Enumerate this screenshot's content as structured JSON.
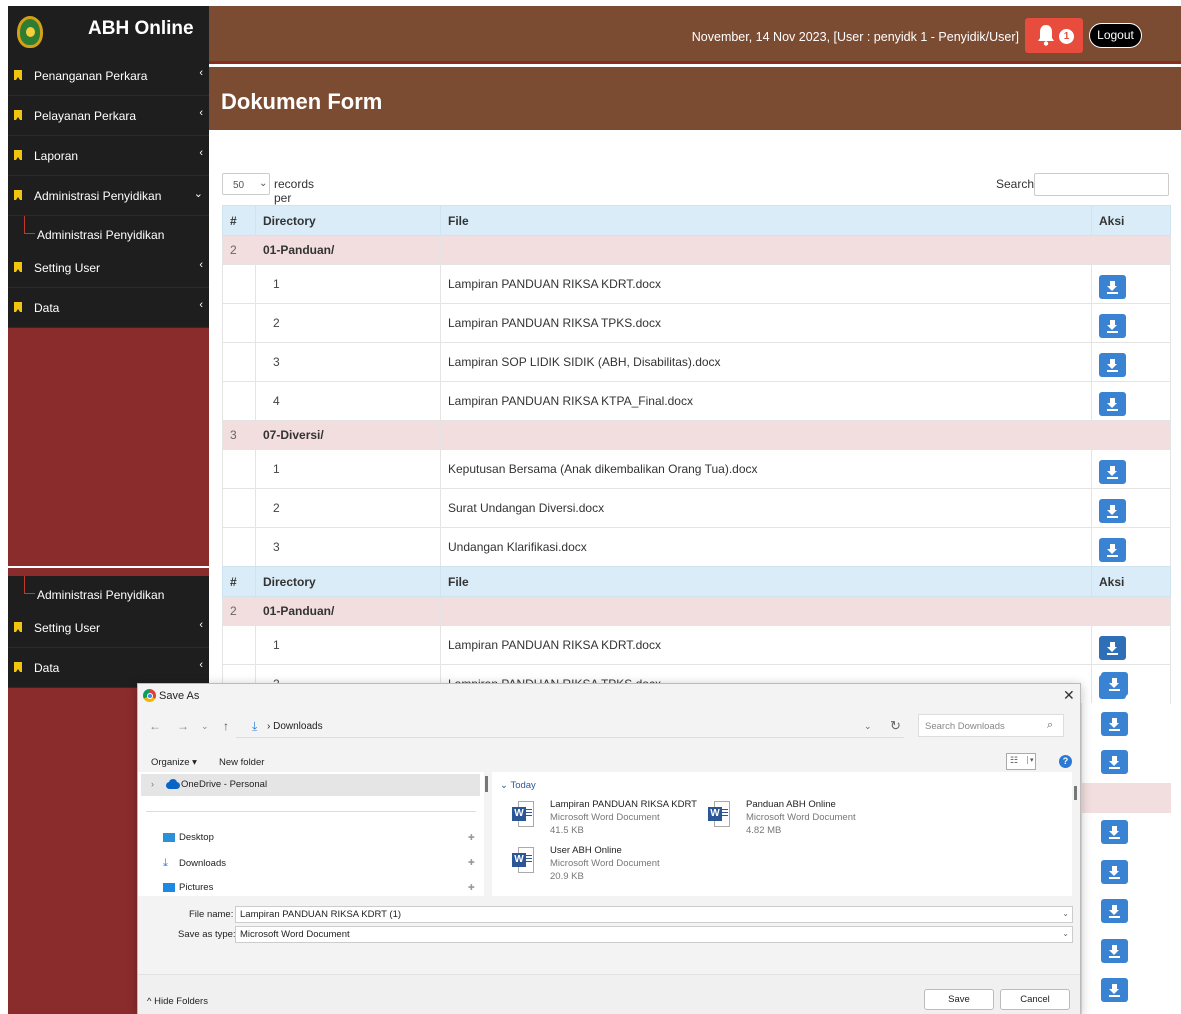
{
  "app": {
    "title": "ABH Online"
  },
  "header": {
    "user_info": "November, 14 Nov 2023, [User : penyidk 1 - Penyidik/User]",
    "notification_count": "1",
    "logout_label": "Logout"
  },
  "page": {
    "title": "Dokumen Form"
  },
  "sidebar": {
    "items": [
      {
        "label": "Penanganan Perkara"
      },
      {
        "label": "Pelayanan Perkara"
      },
      {
        "label": "Laporan"
      },
      {
        "label": "Administrasi Penyidikan"
      },
      {
        "label": "Administrasi Penyidikan"
      },
      {
        "label": "Setting User"
      },
      {
        "label": "Data"
      }
    ],
    "bottom_items": [
      {
        "label": "Administrasi Penyidikan"
      },
      {
        "label": "Setting User"
      },
      {
        "label": "Data"
      }
    ]
  },
  "table_controls": {
    "page_size": "50",
    "records_label": "records per page",
    "search_label": "Search:"
  },
  "table": {
    "headers": {
      "num": "#",
      "directory": "Directory",
      "file": "File",
      "aksi": "Aksi"
    },
    "groups": [
      {
        "num": "2",
        "directory": "01-Panduan/",
        "files": [
          {
            "idx": "1",
            "name": "Lampiran PANDUAN RIKSA KDRT.docx"
          },
          {
            "idx": "2",
            "name": "Lampiran PANDUAN RIKSA TPKS.docx"
          },
          {
            "idx": "3",
            "name": "Lampiran SOP LIDIK SIDIK (ABH, Disabilitas).docx"
          },
          {
            "idx": "4",
            "name": "Lampiran PANDUAN RIKSA KTPA_Final.docx"
          }
        ]
      },
      {
        "num": "3",
        "directory": "07-Diversi/",
        "files": [
          {
            "idx": "1",
            "name": "Keputusan Bersama (Anak dikembalikan Orang Tua).docx"
          },
          {
            "idx": "2",
            "name": "Surat Undangan Diversi.docx"
          },
          {
            "idx": "3",
            "name": "Undangan Klarifikasi.docx"
          }
        ]
      }
    ]
  },
  "table2": {
    "group": {
      "num": "2",
      "directory": "01-Panduan/"
    },
    "files": [
      {
        "idx": "1",
        "name": "Lampiran PANDUAN RIKSA KDRT.docx"
      },
      {
        "idx": "2",
        "name": "Lampiran PANDUAN RIKSA TPKS.docx"
      }
    ]
  },
  "dialog": {
    "title": "Save As",
    "address": "Downloads",
    "search_placeholder": "Search Downloads",
    "organize_label": "Organize ▾",
    "new_folder_label": "New folder",
    "nav": {
      "onedrive": "OneDrive - Personal",
      "quick_access": [
        {
          "label": "Desktop"
        },
        {
          "label": "Downloads"
        },
        {
          "label": "Pictures"
        }
      ]
    },
    "group_label": "Today",
    "files": [
      {
        "name": "Lampiran PANDUAN RIKSA KDRT",
        "type": "Microsoft Word Document",
        "size": "41.5 KB"
      },
      {
        "name": "Panduan ABH Online",
        "type": "Microsoft Word Document",
        "size": "4.82 MB"
      },
      {
        "name": "User ABH Online",
        "type": "Microsoft Word Document",
        "size": "20.9 KB"
      }
    ],
    "file_name_label": "File name:",
    "file_name_value": "Lampiran PANDUAN RIKSA KDRT (1)",
    "save_type_label": "Save as type:",
    "save_type_value": "Microsoft Word Document",
    "hide_folders_label": "Hide Folders",
    "save_label": "Save",
    "cancel_label": "Cancel"
  },
  "colors": {
    "brand_brown": "#7b4b32",
    "sidebar_dark": "#1e1e1e",
    "sidebar_red": "#8b2c2c",
    "accent_blue": "#3a83d3",
    "alert_red": "#e74c3c",
    "group_row": "#f2dede",
    "header_row": "#d9ecf7"
  }
}
